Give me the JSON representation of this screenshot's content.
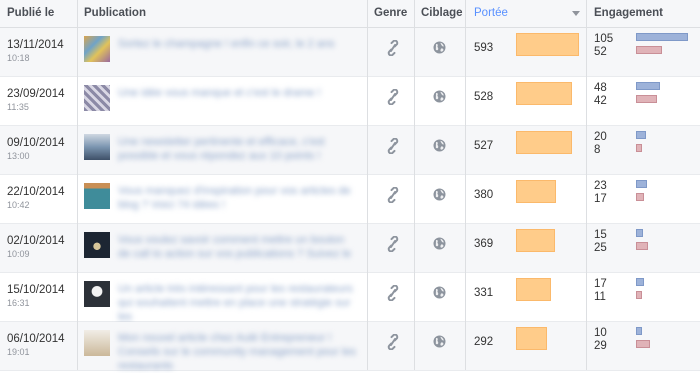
{
  "header": {
    "published": "Publié le",
    "publication": "Publication",
    "genre": "Genre",
    "targeting": "Ciblage",
    "reach": "Portée",
    "engagement": "Engagement"
  },
  "colors": {
    "reach_bar": "#ffcc8a",
    "engagement_bar_1": "#9db2d9",
    "engagement_bar_2": "#e0b3b8",
    "active_header": "#5890ff"
  },
  "posts": [
    {
      "date": "13/11/2014",
      "time": "10:18",
      "text": "Sortez le champagne ! enfin ce soir, le 2 ans",
      "thumb": "colorful-grid",
      "reach": 593,
      "eng1": 105,
      "eng2": 52
    },
    {
      "date": "23/09/2014",
      "time": "11:35",
      "text": "Une idée vous manque et c'est le drame !",
      "thumb": "pattern",
      "reach": 528,
      "eng1": 48,
      "eng2": 42
    },
    {
      "date": "09/10/2014",
      "time": "13:00",
      "text": "Une newsletter pertinente et efficace, c'est possible et vous répondez aux 10 points !",
      "thumb": "landscape",
      "reach": 527,
      "eng1": 20,
      "eng2": 8
    },
    {
      "date": "22/10/2014",
      "time": "10:42",
      "text": "Vous manquez d'inspiration pour vos articles de blog ? Voici 74 idées !",
      "thumb": "teal-cover",
      "reach": 380,
      "eng1": 23,
      "eng2": 17
    },
    {
      "date": "02/10/2014",
      "time": "10:09",
      "text": "Vous voulez savoir comment mettre un bouton de call to action sur vos publications ? Suivez le",
      "thumb": "dark-poster",
      "reach": 369,
      "eng1": 15,
      "eng2": 25
    },
    {
      "date": "15/10/2014",
      "time": "16:31",
      "text": "Un article très intéressant pour les restaurateurs qui souhaitent mettre en place une stratégie sur les",
      "thumb": "chef",
      "reach": 331,
      "eng1": 17,
      "eng2": 11
    },
    {
      "date": "06/10/2014",
      "time": "19:01",
      "text": "Mon nouvel article chez Aulé Entrepreneur ! Conseils sur le community management pour les restaurants",
      "thumb": "card",
      "reach": 292,
      "eng1": 10,
      "eng2": 29
    }
  ]
}
